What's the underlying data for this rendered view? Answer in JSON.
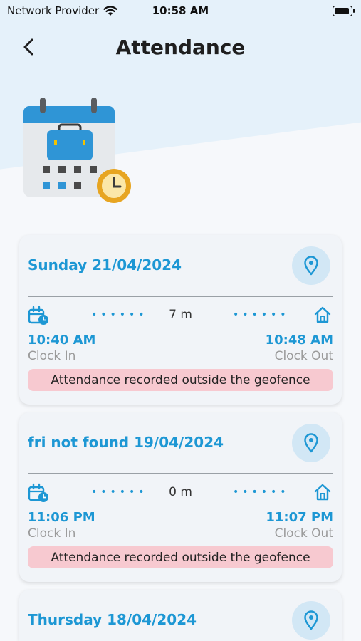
{
  "status_bar": {
    "carrier": "Network Provider",
    "time": "10:58 AM"
  },
  "header": {
    "title": "Attendance"
  },
  "icons": {
    "back": "chevron-left-icon",
    "location": "location-pin-icon",
    "clock_in": "calendar-clock-icon",
    "clock_out": "home-icon"
  },
  "colors": {
    "accent": "#1d97d4",
    "warning_bg": "#f7c9d0",
    "card_bg": "#f1f4f8"
  },
  "cards": [
    {
      "date": "Sunday 21/04/2024",
      "duration": "7 m",
      "clock_in_time": "10:40 AM",
      "clock_in_label": "Clock In",
      "clock_out_time": "10:48 AM",
      "clock_out_label": "Clock Out",
      "warning": "Attendance recorded outside the geofence"
    },
    {
      "date": "fri not found 19/04/2024",
      "duration": "0 m",
      "clock_in_time": "11:06 PM",
      "clock_in_label": "Clock In",
      "clock_out_time": "11:07 PM",
      "clock_out_label": "Clock Out",
      "warning": "Attendance recorded outside the geofence"
    },
    {
      "date": "Thursday 18/04/2024"
    }
  ]
}
